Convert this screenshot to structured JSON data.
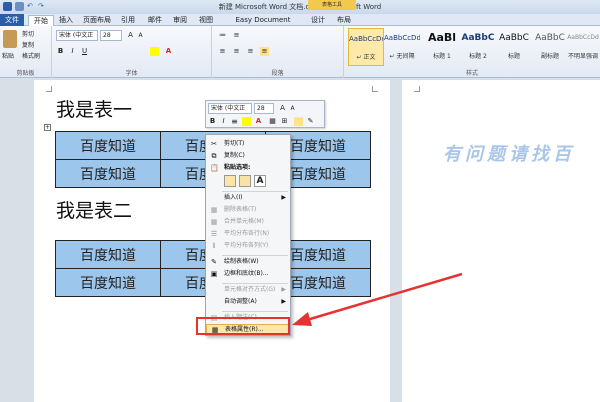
{
  "window": {
    "title": "新建 Microsoft Word 文档.docx - Microsoft Word",
    "context_group": "表格工具"
  },
  "tabs": [
    "文件",
    "开始",
    "插入",
    "页面布局",
    "引用",
    "邮件",
    "审阅",
    "视图",
    "Easy Document Creator",
    "设计",
    "布局"
  ],
  "ribbon": {
    "clipboard": {
      "paste": "粘贴",
      "cut": "剪切",
      "copy": "复制",
      "format_painter": "格式刷",
      "label": "剪贴板"
    },
    "font": {
      "name": "宋体 (中文正",
      "size": "28",
      "label": "字体",
      "bold": "B",
      "italic": "I",
      "underline": "U"
    },
    "paragraph": {
      "label": "段落"
    },
    "styles": {
      "label": "样式",
      "items": [
        {
          "sample": "AaBbCcDd",
          "name": "↵ 正文"
        },
        {
          "sample": "AaBbCcDd",
          "name": "↵ 无间隔"
        },
        {
          "sample": "AaBl",
          "name": "标题 1"
        },
        {
          "sample": "AaBbC",
          "name": "标题 2"
        },
        {
          "sample": "AaBbC",
          "name": "标题"
        },
        {
          "sample": "AaBbC",
          "name": "副标题"
        },
        {
          "sample": "AaBbCcDd",
          "name": "不明显强调"
        }
      ]
    }
  },
  "document": {
    "heading1": "我是表一",
    "heading2": "我是表二",
    "cell_text": "百度知道",
    "table1": [
      [
        "百度知道",
        "百度知道",
        "百度知道"
      ],
      [
        "百度知道",
        "百度知道",
        "百度知道"
      ]
    ],
    "table2": [
      [
        "百度知道",
        "百度知道",
        "百度知道"
      ],
      [
        "百度知道",
        "百度知道",
        "百度知道"
      ]
    ],
    "watermark": "有问题请找百"
  },
  "mini_toolbar": {
    "font": "宋体 (中文正",
    "size": "28"
  },
  "context_menu": {
    "cut": "剪切(T)",
    "copy": "复制(C)",
    "paste_options": "粘贴选项:",
    "insert": "插入(I)",
    "delete_cells": "删除表格(T)",
    "merge_cells": "合并单元格(M)",
    "distribute_rows": "平均分布各行(N)",
    "distribute_cols": "平均分布各列(Y)",
    "draw_table": "绘制表格(W)",
    "borders": "边框和底纹(B)...",
    "cell_alignment": "单元格对齐方式(G)",
    "autofit": "自动调整(A)",
    "insert_caption": "插入题注(C)...",
    "table_properties": "表格属性(R)..."
  },
  "colors": {
    "accent": "#2a5ea8",
    "table_fill": "#9dc6ec",
    "highlight": "#e63232",
    "watermark": "#a9c6ea"
  }
}
